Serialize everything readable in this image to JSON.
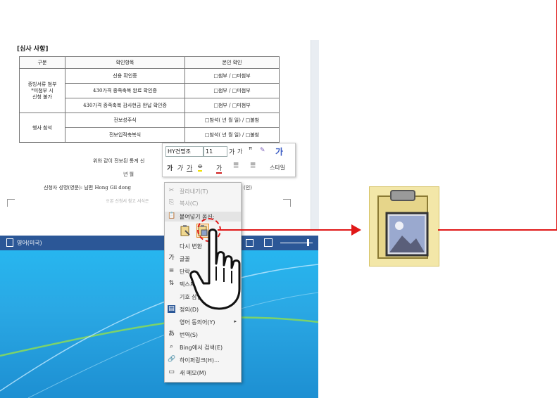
{
  "document": {
    "section_title": "[심사 사항]",
    "table": {
      "headers": [
        "구분",
        "확인항목",
        "본인 확인"
      ],
      "group1_label": "증빙서류 첨부\n*미첨부 시\n신청 불가",
      "group1_rows": [
        {
          "item": "신용 확인증",
          "check": "□첨부 / □미첨부"
        },
        {
          "item": "430가격 종족축복 완료 확인증",
          "check": "□첨부 / □미첨부"
        },
        {
          "item": "430가격 종족축복 감사헌금 완납 확인증",
          "check": "□첨부 / □미첨부"
        }
      ],
      "group2_label": "행사 참석",
      "group2_rows": [
        {
          "item": "전보성주식",
          "check": "□참석( 년 월 일) / □불참"
        },
        {
          "item": "전보입적축복식",
          "check": "□참석( 년 월 일) / □불참"
        }
      ]
    },
    "line1": "위와 같이 전보된 통계 신",
    "line2": "년     월",
    "signature_line": "신청자 성명(영문): 남편 Hong Gil dong",
    "sign_suffix": "(인)",
    "footer_faint": "※본 신청서 참고 서식은"
  },
  "status_bar": {
    "language": "영어(미국)"
  },
  "mini_toolbar": {
    "font_name": "HY견명조",
    "font_size": "11",
    "style_label": "스타일",
    "grow_font": "가",
    "shrink_font": "가",
    "bold": "가",
    "italic": "가",
    "underline": "가"
  },
  "context_menu": {
    "items": [
      {
        "label": "잘라내기(T)",
        "icon": "scissors-icon",
        "disabled": true
      },
      {
        "label": "복사(C)",
        "icon": "copy-icon",
        "disabled": true
      },
      {
        "label": "붙여넣기 옵션:",
        "icon": "paste-icon",
        "disabled": false
      },
      {
        "label": "다시 변환",
        "icon": "",
        "disabled": false
      },
      {
        "label": "글꼴",
        "icon": "font-icon",
        "disabled": false
      },
      {
        "label": "단락",
        "icon": "paragraph-icon",
        "disabled": false
      },
      {
        "label": "텍스트",
        "icon": "text-direction-icon",
        "disabled": false
      },
      {
        "label": "기호 삽입",
        "icon": "",
        "disabled": false
      },
      {
        "label": "정의(D)",
        "icon": "definition-icon",
        "disabled": false
      },
      {
        "label": "영어 동의어(Y)",
        "icon": "",
        "disabled": false,
        "submenu": true
      },
      {
        "label": "번역(S)",
        "icon": "translate-icon",
        "disabled": false
      },
      {
        "label": "Bing에서 검색(E)",
        "icon": "search-icon",
        "disabled": false
      },
      {
        "label": "하이퍼링크(H)...",
        "icon": "hyperlink-icon",
        "disabled": false
      },
      {
        "label": "새 메모(M)",
        "icon": "comment-icon",
        "disabled": false
      }
    ]
  },
  "colors": {
    "annotation_red": "#e01818",
    "statusbar_blue": "#2b5797",
    "desktop_blue": "#27b6ef",
    "zoom_icon_bg": "#f3e7a8"
  }
}
